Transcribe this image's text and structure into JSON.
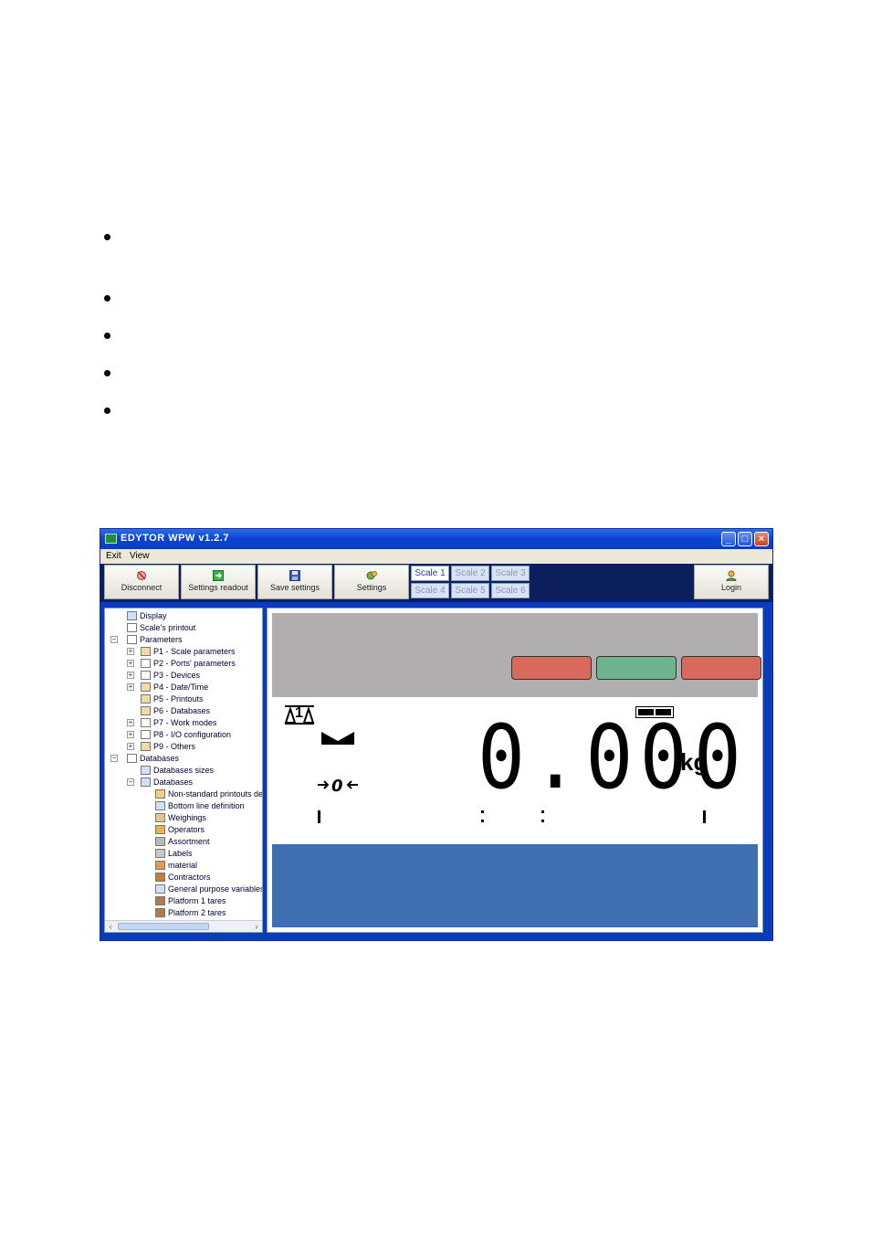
{
  "window": {
    "title": "EDYTOR WPW v1.2.7"
  },
  "menu": [
    "Exit",
    "View"
  ],
  "toolbar": {
    "disconnect": "Disconnect",
    "settings_readout": "Settings readout",
    "save_settings": "Save settings",
    "settings": "Settings",
    "login": "Login"
  },
  "scales": [
    "Scale 1",
    "Scale 2",
    "Scale 3",
    "Scale 4",
    "Scale 5",
    "Scale 6"
  ],
  "tree": [
    "Display",
    "Scale's printout",
    "Parameters",
    "P1 - Scale parameters",
    "P2 - Ports' parameters",
    "P3 - Devices",
    "P4 - Date/Time",
    "P5 - Printouts",
    "P6 - Databases",
    "P7 - Work modes",
    "P8 - I/O configuration",
    "P9 - Others",
    "Databases",
    "Databases sizes",
    "Databases",
    "Non-standard printouts def",
    "Bottom line definition",
    "Weighings",
    "Operators",
    "Assortment",
    "Labels",
    "material",
    "Contractors",
    "General purpose variables",
    "Platform 1 tares",
    "Platform 2 tares"
  ],
  "display": {
    "weight": "0.000",
    "unit": "kg",
    "platform": "1",
    "indicator_colors": [
      "#d9695a",
      "#6fb38f",
      "#d9695a"
    ]
  }
}
